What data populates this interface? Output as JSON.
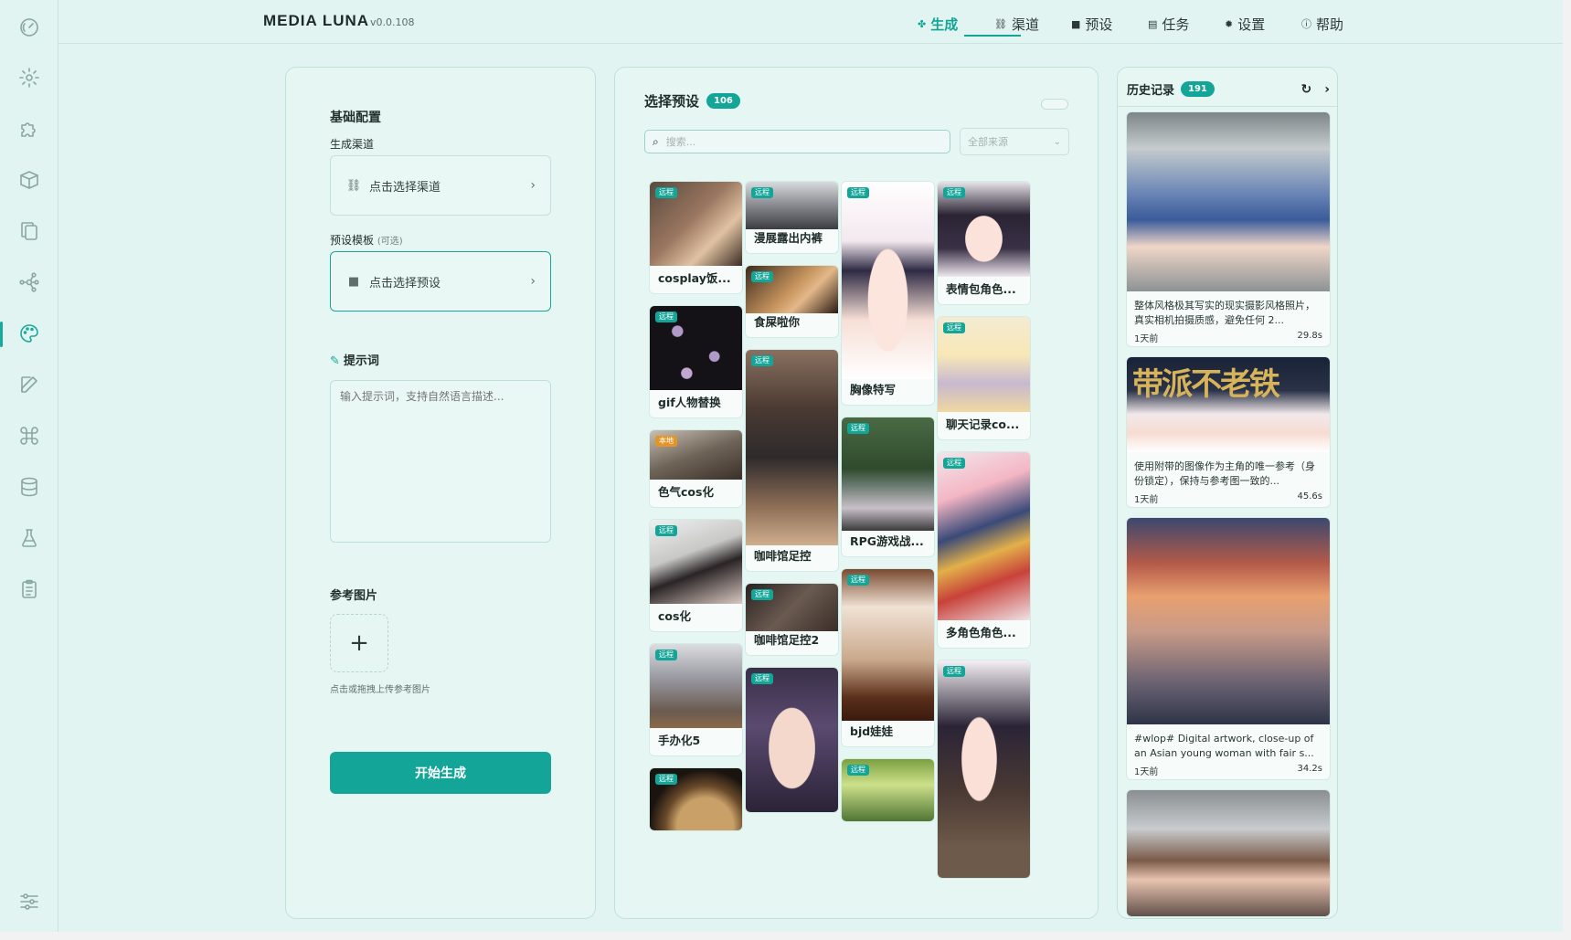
{
  "app": {
    "brand": "MEDIA LUNA",
    "version": "v0.0.108"
  },
  "nav": [
    {
      "icon": "✤",
      "icon_name": "sparkle-icon",
      "label": "生成",
      "active": true
    },
    {
      "icon": "⛓",
      "icon_name": "link-icon",
      "label": "渠道",
      "active": false
    },
    {
      "icon": "■",
      "icon_name": "bookmark-icon",
      "label": "预设",
      "active": false
    },
    {
      "icon": "▤",
      "icon_name": "clipboard-icon",
      "label": "任务",
      "active": false
    },
    {
      "icon": "✹",
      "icon_name": "gear-icon",
      "label": "设置",
      "active": false
    },
    {
      "icon": "ⓘ",
      "icon_name": "help-icon",
      "label": "帮助",
      "active": false
    }
  ],
  "sidebar_icons": [
    "dashboard-icon",
    "gear-icon",
    "puzzle-icon",
    "box-icon",
    "copy-icon",
    "network-icon",
    "palette-icon",
    "edit-icon",
    "command-icon",
    "database-icon",
    "flask-icon",
    "clipboard-list-icon",
    "sliders-icon"
  ],
  "left": {
    "section_title": "基础配置",
    "channel_label": "生成渠道",
    "channel_placeholder": "点击选择渠道",
    "preset_label": "预设模板",
    "preset_optional": "(可选)",
    "preset_placeholder": "点击选择预设",
    "prompt_label": "提示词",
    "prompt_placeholder": "输入提示词，支持自然语言描述...",
    "ref_label": "参考图片",
    "upload_hint": "点击或拖拽上传参考图片",
    "submit": "开始生成"
  },
  "presets": {
    "title": "选择预设",
    "count": "106",
    "search_placeholder": "搜索...",
    "source_select": "全部来源",
    "columns": [
      [
        {
          "name": "cosplay饭...",
          "tag": "远程",
          "h": 124,
          "img": 92,
          "g": "linear-gradient(135deg,#5a4a3e,#9a7660 45%,#e0c2a2 70%,#3b2c24)"
        },
        {
          "name": "gif人物替换",
          "tag": "远程",
          "h": 124,
          "img": 92,
          "g": "radial-gradient(circle at 30% 30%,#b09ac8 0 6%,transparent 7%),radial-gradient(circle at 70% 60%,#b09ac8 0 6%,transparent 7%),radial-gradient(circle at 40% 80%,#c0a8d0 0 6%,transparent 7%),#141216"
        },
        {
          "name": "色气cos化",
          "tag": "本地",
          "local": true,
          "h": 86,
          "img": 54,
          "g": "linear-gradient(160deg,#c9c0b3,#6e6458 50%,#3a3028)"
        },
        {
          "name": "cos化",
          "tag": "远程",
          "h": 124,
          "img": 92,
          "g": "linear-gradient(160deg,#eef0f0,#c8c8c6 40%,#2a2426 60%,#d8c8c0)"
        },
        {
          "name": "手办化5",
          "tag": "远程",
          "h": 124,
          "img": 92,
          "g": "linear-gradient(180deg,#dcdde0,#9a9aa2 40%,#6a5a50 80%,#8a6a4a)"
        },
        {
          "name": "",
          "tag": "远程",
          "h": 70,
          "img": 70,
          "g": "radial-gradient(circle at 60% 90%,#c8a068 0 35%,#6a4a2a 50%,#1a1410 70%)"
        }
      ],
      [
        {
          "name": "漫展露出内裤",
          "tag": "远程",
          "h": 80,
          "img": 52,
          "g": "linear-gradient(180deg,#d9dadd,#7f8186 55%,#3b3d42)"
        },
        {
          "name": "食屎啦你",
          "tag": "远程",
          "h": 80,
          "img": 52,
          "g": "linear-gradient(135deg,#3c2a1e,#c7955e 50%,#e4b88a 65%,#2a1a12)"
        },
        {
          "name": "咖啡馆足控",
          "tag": "远程",
          "h": 244,
          "img": 214,
          "g": "linear-gradient(180deg,#8a7060,#4a3a32 30%,#2e2a2c 55%,#8d6e56 80%,#cfae8e)"
        },
        {
          "name": "咖啡馆足控2",
          "tag": "远程",
          "h": 80,
          "img": 52,
          "g": "linear-gradient(135deg,#2a2220,#6a5a50 50%,#3a2e28)"
        },
        {
          "name": "",
          "tag": "远程",
          "h": 160,
          "img": 160,
          "g": "radial-gradient(ellipse at 50% 55%,#f4d8cc 0 35%,transparent 36%),linear-gradient(180deg,#3a3048,#5a4a70 40%,#2a2236)"
        }
      ],
      [
        {
          "name": "胸像特写",
          "tag": "远程",
          "h": 246,
          "img": 216,
          "g": "radial-gradient(ellipse at 50% 60%,#fbe5dc 0 30%,transparent 31%),linear-gradient(180deg,#ffffff,#f3e8ee 30%,#2e2a44 45%,#f7dfd6 70%,#ffffff)"
        },
        {
          "name": "RPG游戏战...",
          "tag": "远程",
          "h": 154,
          "img": 124,
          "g": "linear-gradient(180deg,#4a6a44,#2f4a2c 45%,#6a7a70 60%,#c9c0c8 80%,#3a3a3a)"
        },
        {
          "name": "bjd娃娃",
          "tag": "远程",
          "h": 196,
          "img": 166,
          "g": "linear-gradient(180deg,#7a4a30,#f0e2d4 25%,#caa88c 60%,#5a2e1a 85%,#3a1a0e)"
        },
        {
          "name": "",
          "tag": "远程",
          "h": 70,
          "img": 70,
          "g": "linear-gradient(180deg,#7aa040,#cde08a 40%,#4a7030)"
        }
      ],
      [
        {
          "name": "表情包角色...",
          "tag": "远程",
          "h": 136,
          "img": 104,
          "g": "radial-gradient(ellipse at 50% 60%,#fbe2da 0 28%,transparent 29%),linear-gradient(180deg,#e8e2ea,#2a2434 35%,#3a3046 70%,#efe8ee)"
        },
        {
          "name": "聊天记录co...",
          "tag": "远程",
          "h": 136,
          "img": 104,
          "g": "linear-gradient(180deg,#f4ead2,#f8e8b6 40%,#c8b8d0 70%,#f0d8a0)"
        },
        {
          "name": "多角色角色...",
          "tag": "远程",
          "h": 216,
          "img": 184,
          "g": "linear-gradient(160deg,#f2e6ec,#f4b6c4 25%,#3a4a78 45%,#e3b04a 60%,#c8423a 75%,#efe2e6)"
        },
        {
          "name": "",
          "tag": "远程",
          "h": 240,
          "img": 240,
          "g": "radial-gradient(ellipse at 45% 45%,#fbe0d8 0 24%,transparent 25%),linear-gradient(180deg,#f4f0f4,#2a2436 30%,#4a3a34 60%,#6e5a4a 85%)"
        }
      ]
    ]
  },
  "history": {
    "title": "历史记录",
    "count": "191",
    "items": [
      {
        "desc": "整体风格极其写实的现实摄影风格照片，真实相机拍摄质感，避免任何 2...",
        "time": "1天前",
        "duration": "29.8s",
        "img_h": 196,
        "g": "linear-gradient(180deg,#7c8588,#c6ccce 20%,#6b86b6 45%,#3a5b9a 60%,#f0d6c8 75%,#8c9294)"
      },
      {
        "desc": "使用附带的图像作为主角的唯一参考（身份锁定），保持与参考图一致的...",
        "time": "1天前",
        "duration": "45.6s",
        "img_h": 104,
        "overlay": "带派不老铁",
        "g": "linear-gradient(180deg,#1a2238,#2a3248 35%,#f2e8ea 60%,#f6dcd2 80%,#ffffff)"
      },
      {
        "desc": "#wlop# Digital artwork, close-up of an Asian young woman with fair s...",
        "time": "1天前",
        "duration": "34.2s",
        "img_h": 226,
        "g": "linear-gradient(180deg,#3c4870,#b45a48 22%,#e8a070 38%,#c89a88 55%,#6a6272 80%,#2e3448)"
      },
      {
        "desc": "",
        "time": "",
        "duration": "",
        "img_h": 140,
        "g": "linear-gradient(180deg,#8a8e92,#c8ccce 30%,#7a5a48 55%,#e8c4b0 70%,#5a4a44)"
      }
    ]
  },
  "colors": {
    "accent": "#13a698",
    "bg": "#e2f4f1",
    "local_tag": "#e2962a"
  }
}
